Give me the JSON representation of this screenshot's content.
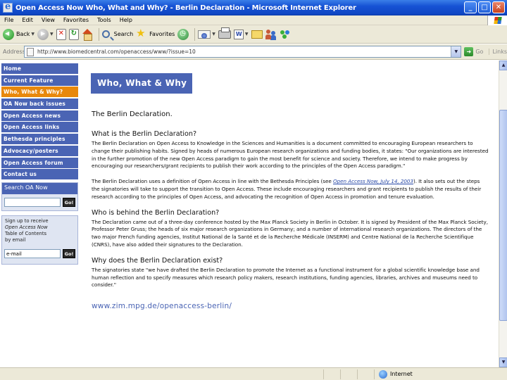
{
  "window": {
    "title": "Open Access Now    Who, What and Why? - Berlin Declaration - Microsoft Internet Explorer",
    "minimize": "_",
    "maximize": "□",
    "close": "✕"
  },
  "menu": [
    "File",
    "Edit",
    "View",
    "Favorites",
    "Tools",
    "Help"
  ],
  "toolbar": {
    "back_label": "Back",
    "search_label": "Search",
    "favorites_label": "Favorites"
  },
  "address": {
    "label": "Address",
    "url": "http://www.biomedcentral.com/openaccess/www/?issue=10",
    "go_label": "Go",
    "links_label": "Links"
  },
  "nav": {
    "items": [
      {
        "label": "Home",
        "active": false
      },
      {
        "label": "Current Feature",
        "active": false
      },
      {
        "label": "Who, What & Why?",
        "active": true
      },
      {
        "label": "OA Now back issues",
        "active": false
      },
      {
        "label": "Open Access news",
        "active": false
      },
      {
        "label": "Open Access links",
        "active": false
      },
      {
        "label": "Bethesda principles",
        "active": false
      },
      {
        "label": "Advocacy/posters",
        "active": false
      },
      {
        "label": "Open Access forum",
        "active": false
      },
      {
        "label": "Contact us",
        "active": false
      }
    ],
    "search_box": {
      "heading": "Search OA Now",
      "go": "Go!"
    },
    "signup_box": {
      "text_1": "Sign up to receive",
      "text_2": "Open Access Now",
      "text_3": "Table of Contents",
      "text_4": "by email",
      "email_value": "e-mail",
      "go": "Go!"
    }
  },
  "page": {
    "section_heading": "Who, What & Why",
    "title": "The Berlin Declaration.",
    "sections": [
      {
        "heading": "What is the Berlin Declaration?",
        "para1": "The Berlin Declaration on Open Access to Knowledge in the Sciences and Humanities is a document committed to encouraging European researchers to change their publishing habits. Signed by heads of numerous European research organizations and funding bodies, it states: \"Our organizations are interested in the further promotion of the new Open Access paradigm to gain the most benefit for science and society. Therefore, we intend to make progress by encouraging our researchers/grant recipients to publish their work according to the principles of the Open Access paradigm.\"",
        "para2_before": "The Berlin Declaration uses a definition of Open Access in line with the Bethesda Principles (see ",
        "para2_link": "Open Access Now, July 14, 2003",
        "para2_after": "). It also sets out the steps the signatories will take to support the transition to Open Access. These include encouraging researchers and grant recipients to publish the results of their research according to the principles of Open Access, and advocating the recognition of Open Access in promotion and tenure evaluation."
      },
      {
        "heading": "Who is behind the Berlin Declaration?",
        "para1": "The Declaration came out of a three-day conference hosted by the Max Planck Society in Berlin in October. It is signed by President of the Max Planck Society, Professor Peter Gruss; the heads of six major research organizations in Germany; and a number of international research organizations. The directors of the two major French funding agencies, Institut National de la Santé et de la Recherche Médicale (INSERM) and Centre National de la Recherche Scientifique (CNRS), have also added their signatures to the Declaration."
      },
      {
        "heading": "Why does the Berlin Declaration exist?",
        "para1": "The signatories state \"we have drafted the Berlin Declaration to promote the Internet as a functional instrument for a global scientific knowledge base and human reflection and to specify measures which research policy makers, research institutions, funding agencies, libraries, archives and museums need to consider.\""
      }
    ],
    "footer_link": "www.zim.mpg.de/openaccess-berlin/"
  },
  "status": {
    "zone": "Internet"
  }
}
